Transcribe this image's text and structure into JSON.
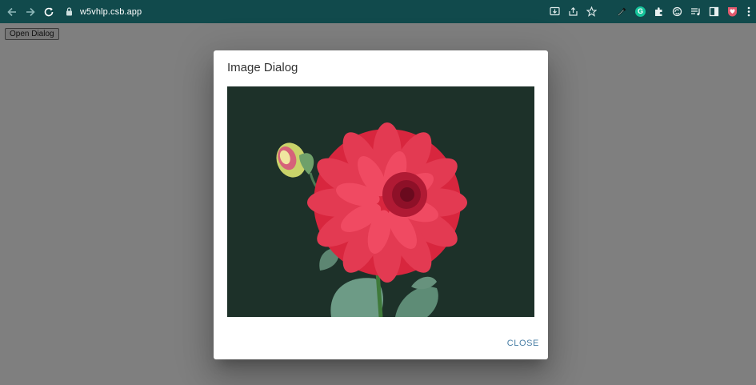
{
  "browser": {
    "url": "w5vhlp.csb.app",
    "accent_color": "#114a4c"
  },
  "page": {
    "open_button_label": "Open Dialog"
  },
  "dialog": {
    "title": "Image Dialog",
    "close_label": "CLOSE",
    "image": {
      "subject": "red dahlia flower with bud on dark green background",
      "background_color": "#1d3129"
    }
  }
}
